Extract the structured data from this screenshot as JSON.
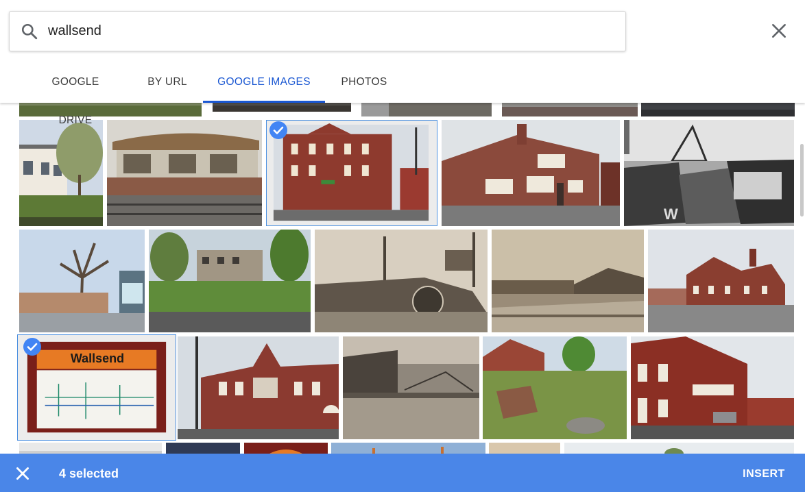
{
  "search": {
    "query": "wallsend"
  },
  "tabs": [
    {
      "label": "GOOGLE DRIVE"
    },
    {
      "label": "BY URL"
    },
    {
      "label": "GOOGLE IMAGES"
    },
    {
      "label": "PHOTOS"
    }
  ],
  "active_tab": "GOOGLE IMAGES",
  "images": {
    "signboard_text": "Wallsend"
  },
  "footer": {
    "selected_label": "4 selected",
    "insert_label": "INSERT"
  },
  "colors": {
    "accent": "#1a57d2",
    "footer_bar": "#4a86e8",
    "check_badge": "#4285f4"
  },
  "icons": {
    "search": "search-icon",
    "close": "close-icon",
    "check": "check-icon"
  }
}
